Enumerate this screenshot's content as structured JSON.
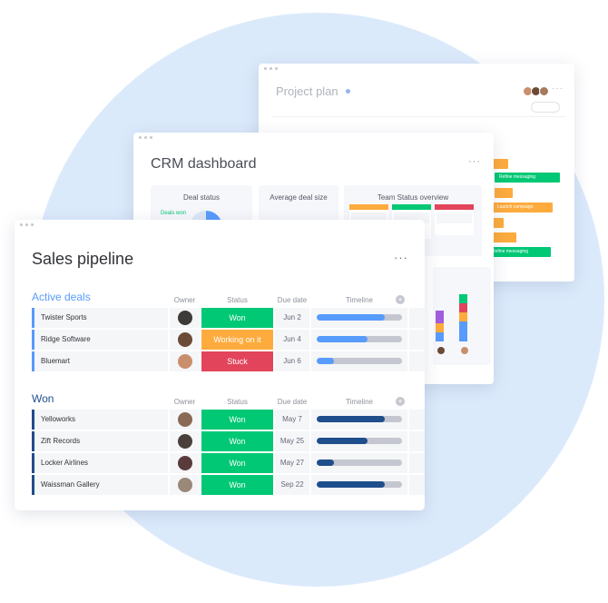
{
  "colors": {
    "won": "#00c875",
    "working": "#fdab3d",
    "stuck": "#e2445c",
    "active_accent": "#579bfc",
    "won_accent": "#1f4e8c",
    "timeline_active": "#579bfc",
    "timeline_won": "#1f4e8c",
    "timeline_track": "#c5c7d0"
  },
  "project_plan": {
    "title": "Project plan",
    "gantt": [
      {
        "color": "#fdab3d",
        "label": ""
      },
      {
        "color": "#00c875",
        "label": "Refine messaging"
      },
      {
        "color": "#fdab3d",
        "label": ""
      },
      {
        "color": "#fdab3d",
        "label": "Launch campaign"
      },
      {
        "color": "#fdab3d",
        "label": ""
      },
      {
        "color": "#fdab3d",
        "label": ""
      },
      {
        "color": "#00c875",
        "label": "Refine messaging"
      }
    ]
  },
  "crm": {
    "title": "CRM dashboard",
    "widgets": {
      "deal_status": "Deal status",
      "deals_won": "Deals won",
      "avg_deal_size": "Average deal size",
      "team_status": "Team Status overview"
    }
  },
  "sales": {
    "title": "Sales pipeline",
    "columns": {
      "owner": "Owner",
      "status": "Status",
      "due": "Due date",
      "timeline": "Timeline"
    },
    "groups": [
      {
        "title": "Active deals",
        "color": "#579bfc",
        "rows": [
          {
            "name": "Twister Sports",
            "status": "Won",
            "status_color": "#00c875",
            "date": "Jun 2",
            "progress": 0.8,
            "avatar": "#3d3a3a"
          },
          {
            "name": "Ridge Software",
            "status": "Working on it",
            "status_color": "#fdab3d",
            "date": "Jun 4",
            "progress": 0.6,
            "avatar": "#6b4a36"
          },
          {
            "name": "Bluemart",
            "status": "Stuck",
            "status_color": "#e2445c",
            "date": "Jun 6",
            "progress": 0.2,
            "avatar": "#c98f6d"
          }
        ]
      },
      {
        "title": "Won",
        "color": "#1f4e8c",
        "rows": [
          {
            "name": "Yelloworks",
            "status": "Won",
            "status_color": "#00c875",
            "date": "May 7",
            "progress": 0.8,
            "avatar": "#8a6a55"
          },
          {
            "name": "Zift Records",
            "status": "Won",
            "status_color": "#00c875",
            "date": "May 25",
            "progress": 0.6,
            "avatar": "#4a3f3a"
          },
          {
            "name": "Locker Airlines",
            "status": "Won",
            "status_color": "#00c875",
            "date": "May 27",
            "progress": 0.2,
            "avatar": "#5a3b3b"
          },
          {
            "name": "Waissman Gallery",
            "status": "Won",
            "status_color": "#00c875",
            "date": "Sep 22",
            "progress": 0.8,
            "avatar": "#9a8878"
          }
        ]
      }
    ]
  }
}
